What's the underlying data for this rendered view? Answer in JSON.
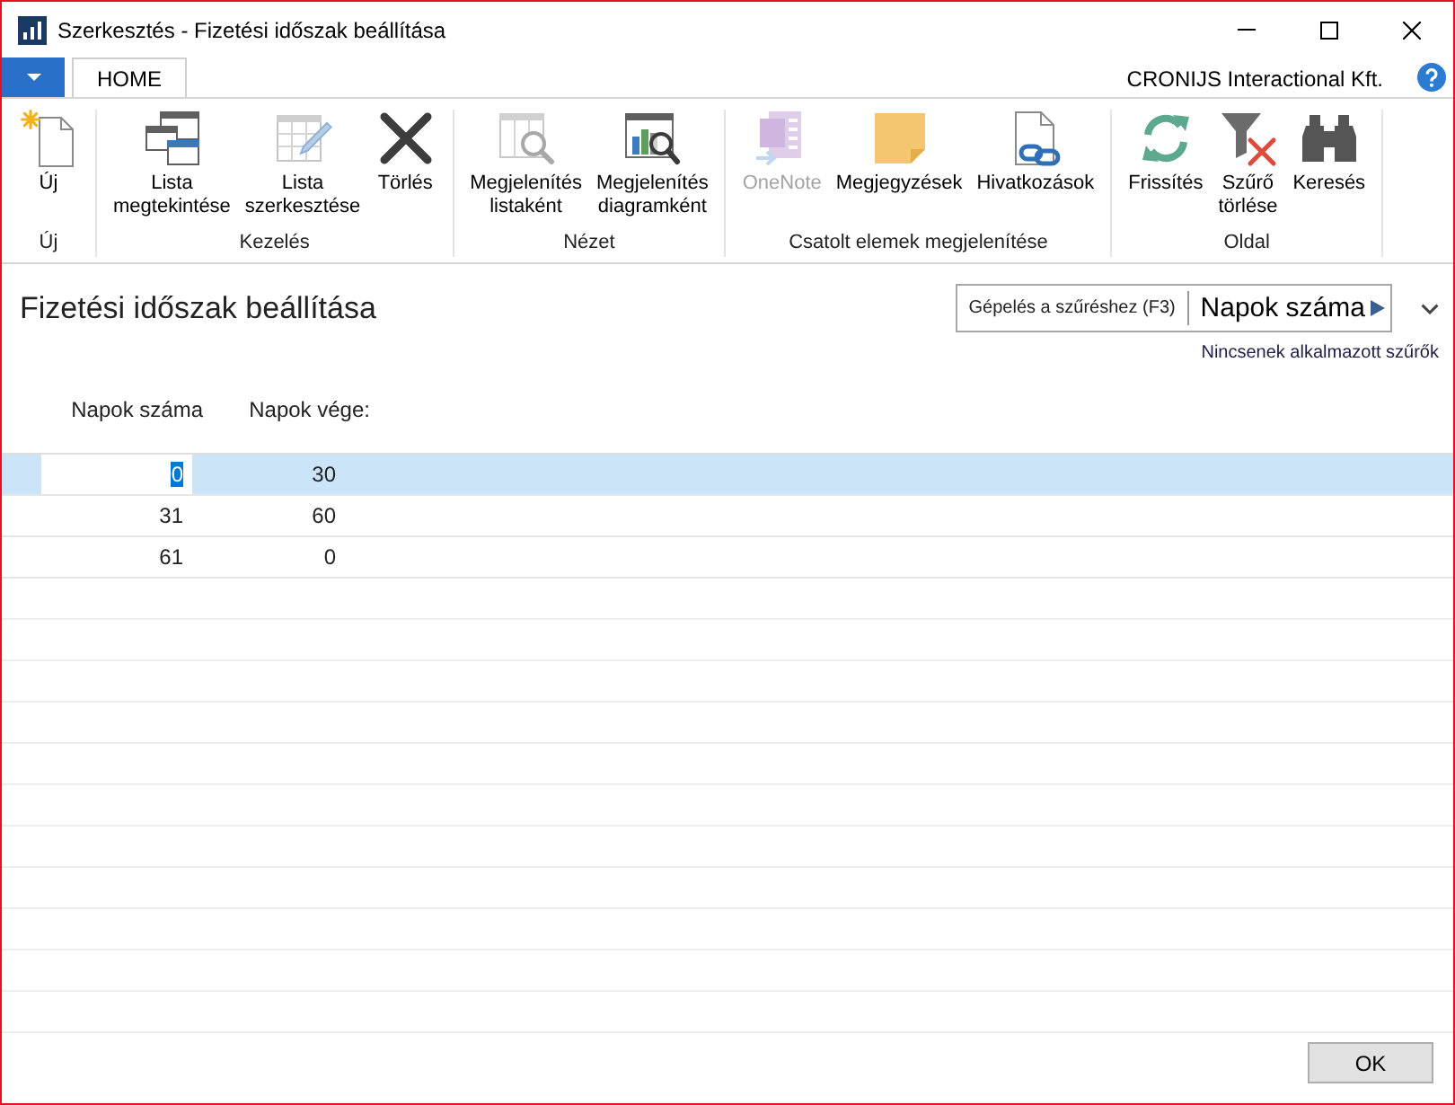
{
  "window": {
    "title": "Szerkesztés - Fizetési időszak beállítása"
  },
  "tabs": [
    {
      "label": "HOME",
      "selected": true
    }
  ],
  "company_name": "CRONIJS Interactional Kft.",
  "ribbon": {
    "groups": [
      {
        "label": "Új",
        "buttons": [
          {
            "kind": "new",
            "label": "Új",
            "disabled": false
          }
        ]
      },
      {
        "label": "Kezelés",
        "buttons": [
          {
            "kind": "view_list",
            "label": "Lista megtekintése",
            "disabled": false
          },
          {
            "kind": "edit_list",
            "label": "Lista szerkesztése",
            "disabled": false
          },
          {
            "kind": "delete",
            "label": "Törlés",
            "disabled": false
          }
        ]
      },
      {
        "label": "Nézet",
        "buttons": [
          {
            "kind": "show_list",
            "label": "Megjelenítés listaként",
            "disabled": false
          },
          {
            "kind": "show_chart",
            "label": "Megjelenítés diagramként",
            "disabled": false
          }
        ]
      },
      {
        "label": "Csatolt elemek megjelenítése",
        "buttons": [
          {
            "kind": "onenote",
            "label": "OneNote",
            "disabled": true
          },
          {
            "kind": "notes",
            "label": "Megjegyzések",
            "disabled": false
          },
          {
            "kind": "links",
            "label": "Hivatkozások",
            "disabled": false
          }
        ]
      },
      {
        "label": "Oldal",
        "buttons": [
          {
            "kind": "refresh",
            "label": "Frissítés",
            "disabled": false
          },
          {
            "kind": "clear_filter",
            "label": "Szűrő törlése",
            "disabled": false
          },
          {
            "kind": "find",
            "label": "Keresés",
            "disabled": false
          }
        ]
      }
    ]
  },
  "page": {
    "title": "Fizetési időszak beállítása",
    "filter": {
      "placeholder": "Gépelés a szűréshez (F3)",
      "column": "Napok száma"
    },
    "filter_status": "Nincsenek alkalmazott szűrők"
  },
  "table": {
    "columns": [
      "Napok száma",
      "Napok vége:"
    ],
    "rows": [
      {
        "selected": true,
        "cells": [
          {
            "text": "0",
            "editing": true
          },
          {
            "text": "30",
            "editing": false
          }
        ]
      },
      {
        "selected": false,
        "cells": [
          {
            "text": "31",
            "editing": false
          },
          {
            "text": "60",
            "editing": false
          }
        ]
      },
      {
        "selected": false,
        "cells": [
          {
            "text": "61",
            "editing": false
          },
          {
            "text": "0",
            "editing": false
          }
        ]
      }
    ]
  },
  "buttons": [
    "OK"
  ]
}
